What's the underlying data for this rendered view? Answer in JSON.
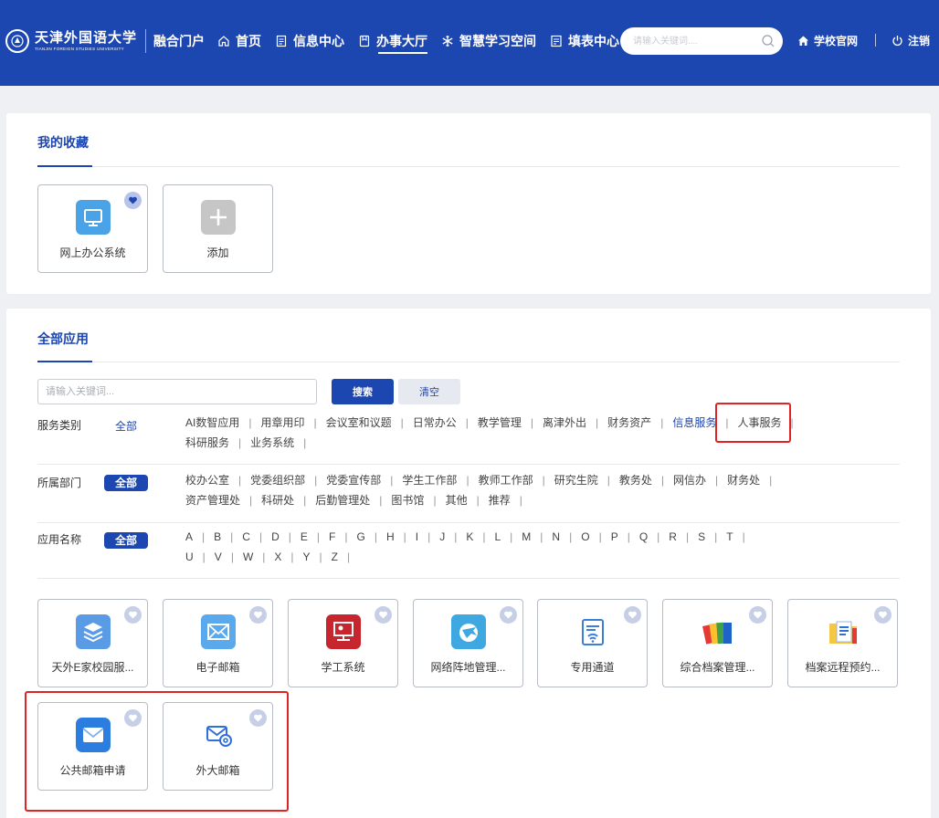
{
  "header": {
    "logo_cn": "天津外国语大学",
    "logo_en": "TIANJIN FOREIGN STUDIES UNIVERSITY",
    "portal_name": "融合门户",
    "nav": [
      {
        "label": "首页",
        "icon": "home-outline-icon"
      },
      {
        "label": "信息中心",
        "icon": "document-icon"
      },
      {
        "label": "办事大厅",
        "icon": "bookmark-icon",
        "active": true
      },
      {
        "label": "智慧学习空间",
        "icon": "snowflake-icon"
      },
      {
        "label": "填表中心",
        "icon": "form-icon"
      }
    ],
    "search_placeholder": "请输入关键词....",
    "school_site": "学校官网",
    "logout": "注销"
  },
  "favorites": {
    "title": "我的收藏",
    "items": [
      {
        "name": "网上办公系统",
        "icon": "monitor-icon",
        "color": "#4aa3e6"
      },
      {
        "name": "添加",
        "icon": "plus-icon",
        "color": "#bdbdbd"
      }
    ]
  },
  "all_apps": {
    "title": "全部应用",
    "keyword_placeholder": "请输入关键词...",
    "search_label": "搜索",
    "clear_label": "清空",
    "filters": [
      {
        "label": "服务类别",
        "all": "全部",
        "options": [
          "AI数智应用",
          "用章用印",
          "会议室和议题",
          "日常办公",
          "教学管理",
          "离津外出",
          "财务资产",
          "信息服务",
          "人事服务",
          "科研服务",
          "业务系统"
        ],
        "selected": "信息服务"
      },
      {
        "label": "所属部门",
        "all": "全部",
        "options": [
          "校办公室",
          "党委组织部",
          "党委宣传部",
          "学生工作部",
          "教师工作部",
          "研究生院",
          "教务处",
          "网信办",
          "财务处",
          "资产管理处",
          "科研处",
          "后勤管理处",
          "图书馆",
          "其他",
          "推荐"
        ]
      },
      {
        "label": "应用名称",
        "all": "全部",
        "options": [
          "A",
          "B",
          "C",
          "D",
          "E",
          "F",
          "G",
          "H",
          "I",
          "J",
          "K",
          "L",
          "M",
          "N",
          "O",
          "P",
          "Q",
          "R",
          "S",
          "T",
          "U",
          "V",
          "W",
          "X",
          "Y",
          "Z"
        ]
      }
    ],
    "apps": [
      {
        "name": "天外E家校园服...",
        "icon": "layers-icon"
      },
      {
        "name": "电子邮箱",
        "icon": "mail-icon"
      },
      {
        "name": "学工系统",
        "icon": "presentation-icon"
      },
      {
        "name": "网络阵地管理...",
        "icon": "globe-plane-icon"
      },
      {
        "name": "专用通道",
        "icon": "wifi-doc-icon"
      },
      {
        "name": "综合档案管理...",
        "icon": "binders-icon"
      },
      {
        "name": "档案远程预约...",
        "icon": "folder-doc-icon"
      },
      {
        "name": "公共邮箱申请",
        "icon": "envelope-icon"
      },
      {
        "name": "外大邮箱",
        "icon": "mail-at-icon"
      }
    ]
  },
  "colors": {
    "brand": "#1c46b0",
    "highlight": "#e02424"
  }
}
